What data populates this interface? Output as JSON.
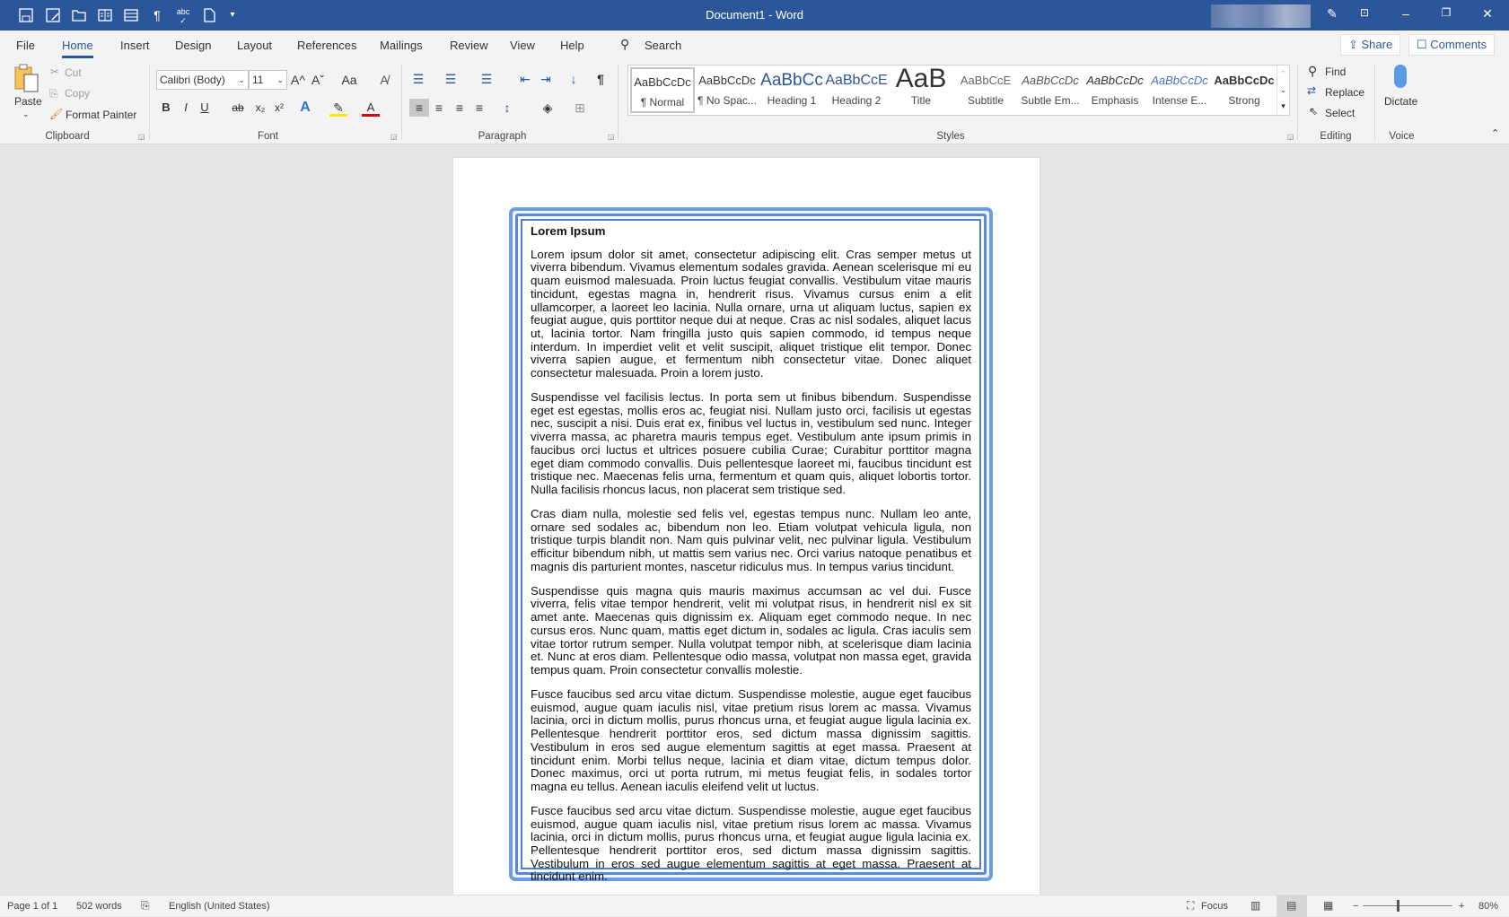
{
  "titlebar": {
    "title": "Document1  -  Word",
    "quick_access": [
      "save-icon",
      "save-as-icon",
      "open-icon",
      "book-view-icon",
      "layout-icon",
      "pilcrow-icon",
      "spelling-icon",
      "new-document-icon",
      "customize-icon"
    ],
    "color": "#2b579a"
  },
  "tabs": [
    "File",
    "Home",
    "Insert",
    "Design",
    "Layout",
    "References",
    "Mailings",
    "Review",
    "View",
    "Help"
  ],
  "active_tab": "Home",
  "search": {
    "label": "Search"
  },
  "share": "Share",
  "comments": "Comments",
  "clipboard": {
    "paste": "Paste",
    "cut": "Cut",
    "copy": "Copy",
    "format_painter": "Format Painter",
    "label": "Clipboard"
  },
  "font": {
    "family": "Calibri (Body)",
    "size": "11",
    "case": "Aa",
    "label": "Font",
    "bold": "B",
    "italic": "I",
    "underline": "U",
    "strike": "ab",
    "sub": "x₂",
    "sup": "x²",
    "text_effect": "A",
    "font_color": "A",
    "grow": "A^",
    "shrink": "Aˇ"
  },
  "paragraph": {
    "label": "Paragraph",
    "pilcrow": "¶"
  },
  "styles": {
    "label": "Styles",
    "items": [
      {
        "preview": "AaBbCcDc",
        "name": "¶ Normal"
      },
      {
        "preview": "AaBbCcDc",
        "name": "¶ No Spac..."
      },
      {
        "preview": "AaBbCc",
        "name": "Heading 1"
      },
      {
        "preview": "AaBbCcE",
        "name": "Heading 2"
      },
      {
        "preview": "AaB",
        "name": "Title"
      },
      {
        "preview": "AaBbCcE",
        "name": "Subtitle"
      },
      {
        "preview": "AaBbCcDc",
        "name": "Subtle Em..."
      },
      {
        "preview": "AaBbCcDc",
        "name": "Emphasis"
      },
      {
        "preview": "AaBbCcDc",
        "name": "Intense E..."
      },
      {
        "preview": "AaBbCcDc",
        "name": "Strong"
      }
    ]
  },
  "editing": {
    "label": "Editing",
    "find": "Find",
    "replace": "Replace",
    "select": "Select"
  },
  "voice": {
    "label": "Voice",
    "dictate": "Dictate"
  },
  "document": {
    "heading": "Lorem Ipsum",
    "paragraphs": [
      "Lorem ipsum dolor sit amet, consectetur adipiscing elit. Cras semper metus ut viverra bibendum. Vivamus elementum sodales gravida. Aenean scelerisque mi eu quam euismod malesuada. Proin luctus feugiat convallis. Vestibulum vitae mauris tincidunt, egestas magna in, hendrerit risus. Vivamus cursus enim a elit ullamcorper, a laoreet leo lacinia. Nulla ornare, urna ut aliquam luctus, sapien ex feugiat augue, quis porttitor neque dui at neque. Cras ac nisl sodales, aliquet lacus ut, lacinia tortor. Nam fringilla justo quis sapien commodo, id tempus neque interdum. In imperdiet velit et velit suscipit, aliquet tristique elit tempor. Donec viverra sapien augue, et fermentum nibh consectetur vitae. Donec aliquet consectetur malesuada. Proin a lorem justo.",
      "Suspendisse vel facilisis lectus. In porta sem ut finibus bibendum. Suspendisse eget est egestas, mollis eros ac, feugiat nisi. Nullam justo orci, facilisis ut egestas nec, suscipit a nisi. Duis erat ex, finibus vel luctus in, vestibulum sed nunc. Integer viverra massa, ac pharetra mauris tempus eget. Vestibulum ante ipsum primis in faucibus orci luctus et ultrices posuere cubilia Curae; Curabitur porttitor magna eget diam commodo convallis. Duis pellentesque laoreet mi, faucibus tincidunt est tristique nec. Maecenas felis urna, fermentum et quam quis, aliquet lobortis tortor. Nulla facilisis rhoncus lacus, non placerat sem tristique sed.",
      "Cras diam nulla, molestie sed felis vel, egestas tempus nunc. Nullam leo ante, ornare sed sodales ac, bibendum non leo. Etiam volutpat vehicula ligula, non tristique turpis blandit non. Nam quis pulvinar velit, nec pulvinar ligula. Vestibulum efficitur bibendum nibh, ut mattis sem varius nec. Orci varius natoque penatibus et magnis dis parturient montes, nascetur ridiculus mus. In tempus varius tincidunt.",
      "Suspendisse quis magna quis mauris maximus accumsan ac vel dui. Fusce viverra, felis vitae tempor hendrerit, velit mi volutpat risus, in hendrerit nisl ex sit amet ante. Maecenas quis dignissim ex. Aliquam eget commodo neque. In nec cursus eros. Nunc quam, mattis eget dictum in, sodales ac ligula. Cras iaculis sem vitae tortor rutrum semper. Nulla volutpat tempor nibh, at scelerisque diam lacinia et. Nunc at eros diam. Pellentesque odio massa, volutpat non massa eget, gravida tempus quam. Proin consectetur convallis molestie.",
      "Fusce faucibus sed arcu vitae dictum. Suspendisse molestie, augue eget faucibus euismod, augue quam iaculis nisl, vitae pretium risus lorem ac massa. Vivamus lacinia, orci in dictum mollis, purus rhoncus urna, et feugiat augue ligula lacinia ex. Pellentesque hendrerit porttitor eros, sed dictum massa dignissim sagittis. Vestibulum in eros sed augue elementum sagittis at eget massa. Praesent at tincidunt enim. Morbi tellus neque, lacinia et diam vitae, dictum tempus dolor. Donec maximus, orci ut porta rutrum, mi metus feugiat felis, in sodales tortor magna eu tellus. Aenean iaculis eleifend velit ut luctus.",
      "Fusce faucibus sed arcu vitae dictum. Suspendisse molestie, augue eget faucibus euismod, augue quam iaculis nisl, vitae pretium risus lorem ac massa. Vivamus lacinia, orci in dictum mollis, purus rhoncus urna, et feugiat augue ligula lacinia ex. Pellentesque hendrerit porttitor eros, sed dictum massa dignissim sagittis. Vestibulum in eros sed augue elementum sagittis at eget massa. Praesent at tincidunt enim."
    ],
    "border_color": "#6b9de0"
  },
  "status": {
    "page": "Page 1 of 1",
    "words": "502 words",
    "language": "English (United States)",
    "focus": "Focus",
    "zoom": "80%",
    "zoom_percent": 80
  }
}
